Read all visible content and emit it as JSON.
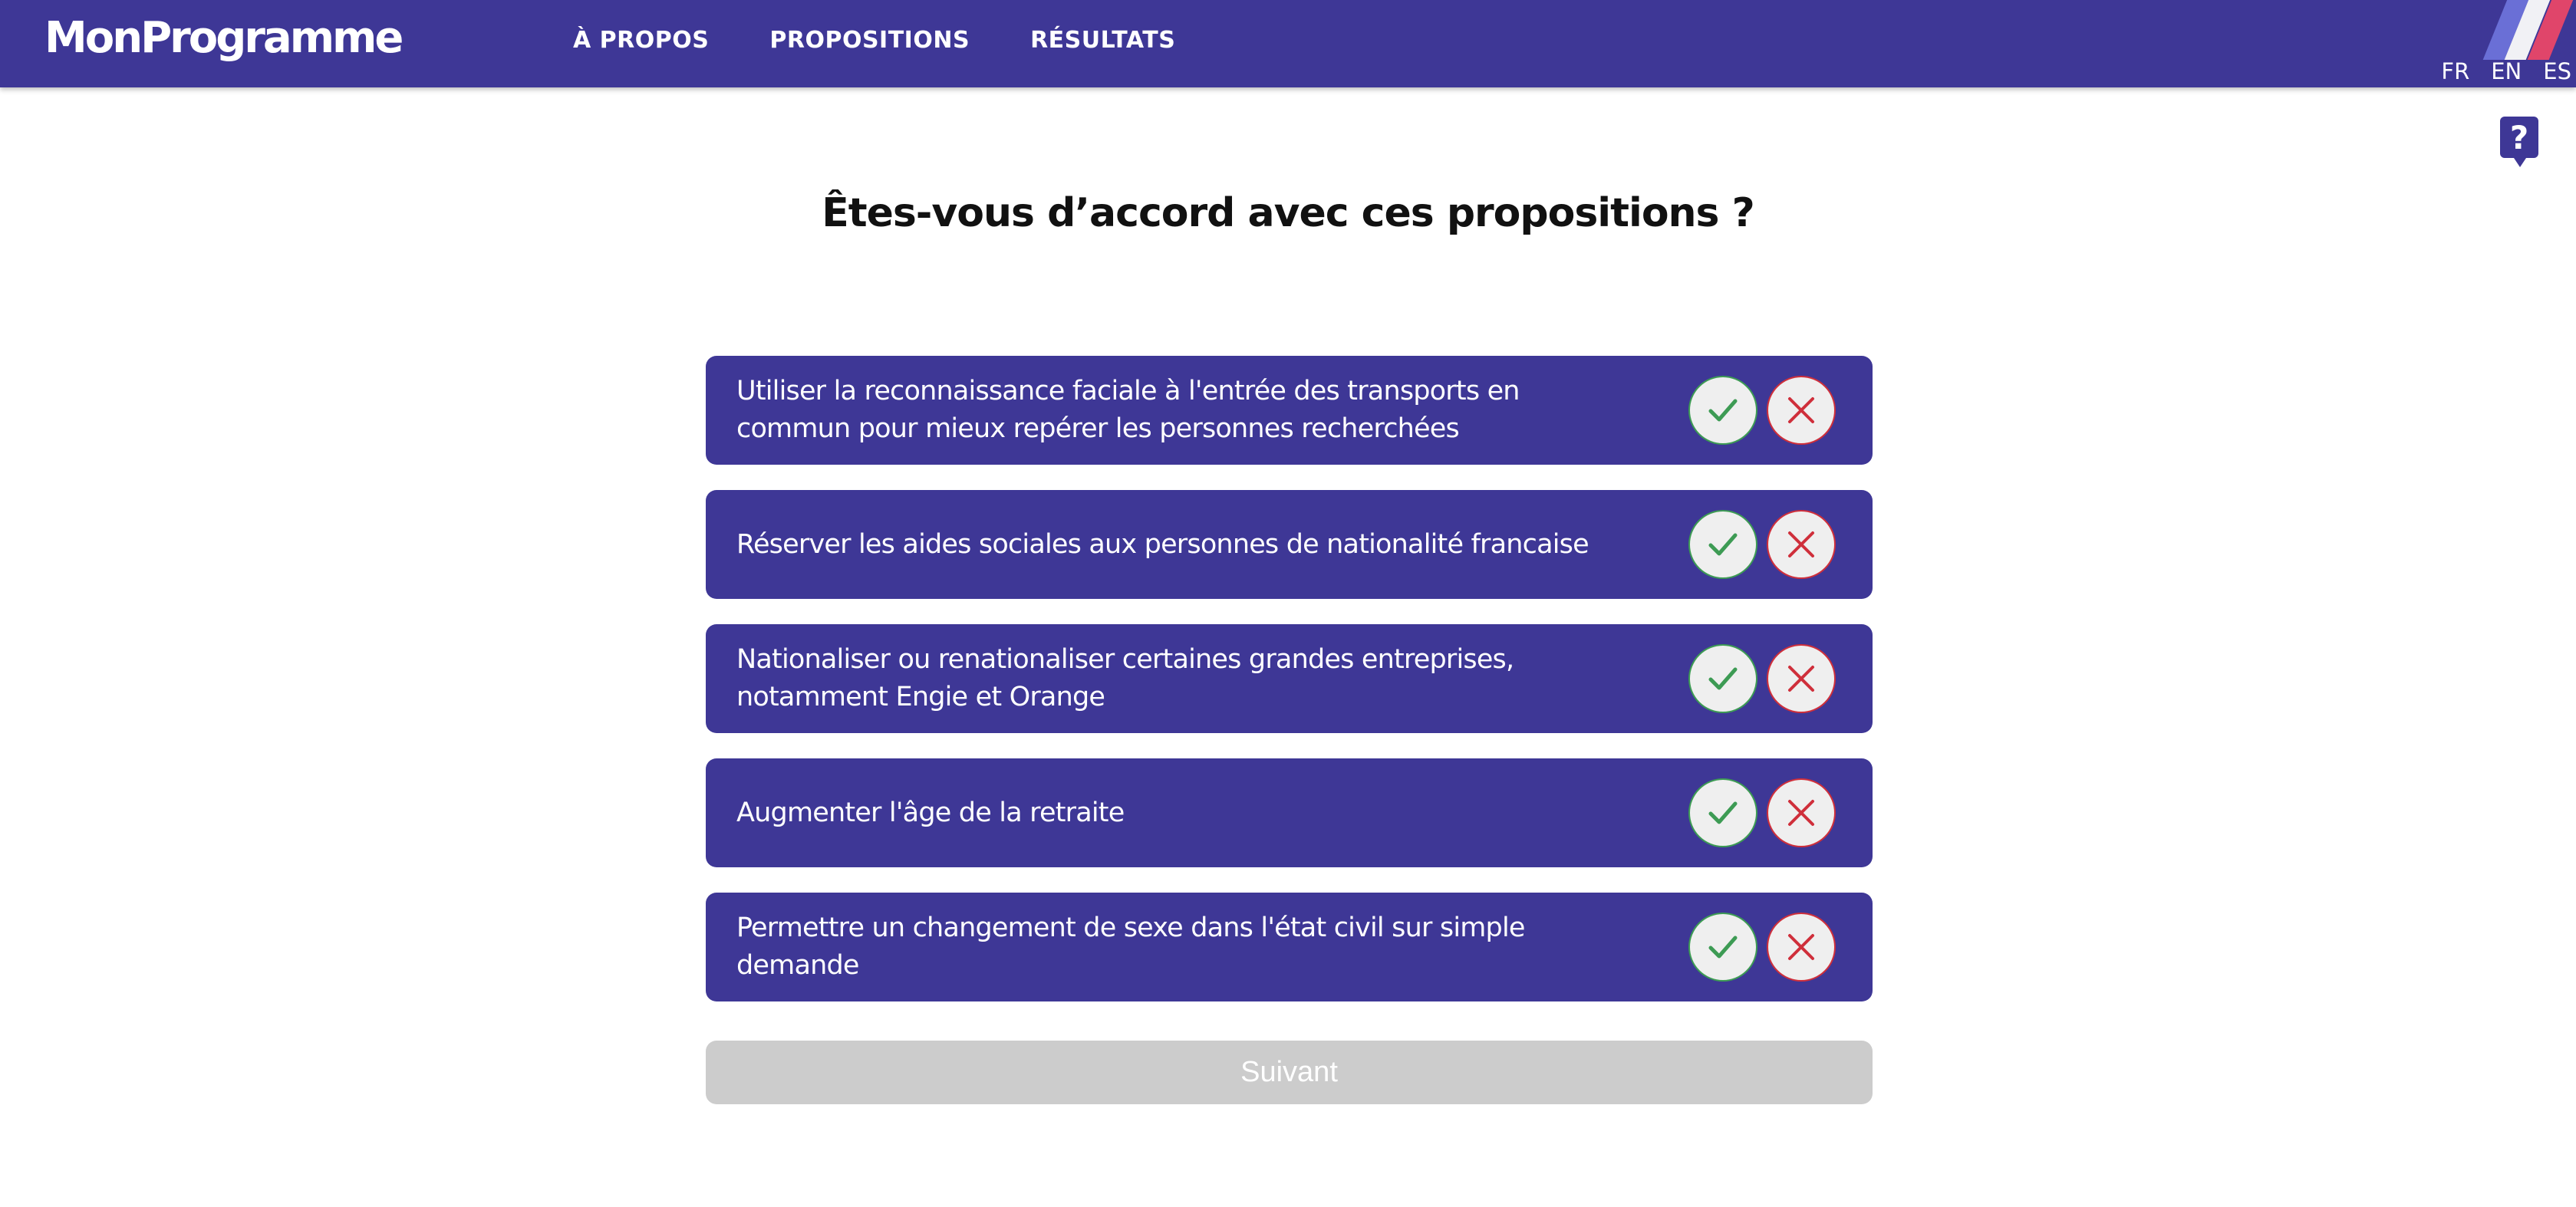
{
  "nav": {
    "logo": "MonProgramme",
    "links": [
      "À PROPOS",
      "PROPOSITIONS",
      "RÉSULTATS"
    ],
    "languages": [
      "FR",
      "EN",
      "ES"
    ]
  },
  "help": {
    "label": "?"
  },
  "page": {
    "title": "Êtes-vous d’accord avec ces propositions ?"
  },
  "propositions": [
    {
      "text": "Utiliser la reconnaissance faciale à l'entrée des transports en commun pour mieux repérer les personnes recherchées"
    },
    {
      "text": "Réserver les aides sociales aux personnes de nationalité francaise"
    },
    {
      "text": "Nationaliser ou renationaliser certaines grandes entreprises, notamment Engie et Orange"
    },
    {
      "text": "Augmenter l'âge de la retraite"
    },
    {
      "text": "Permettre un changement de sexe dans l'état civil sur simple demande"
    }
  ],
  "buttons": {
    "next_label": "Suivant"
  },
  "colors": {
    "primary": "#3e3796",
    "agree": "#3d9b54",
    "disagree": "#cf2f3b",
    "disabled": "#cccccc"
  },
  "icons": {
    "agree": "check-icon",
    "disagree": "x-icon"
  }
}
